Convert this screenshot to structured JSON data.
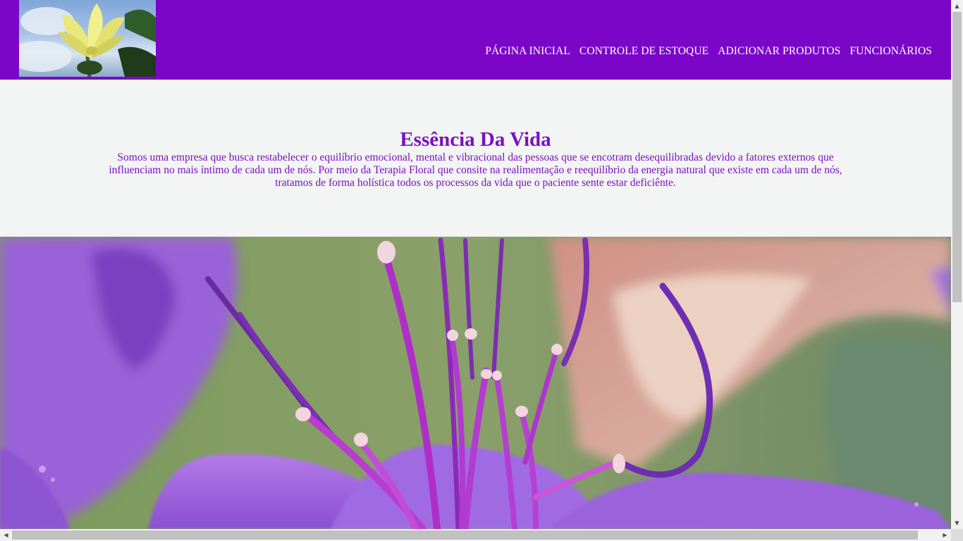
{
  "header": {
    "logo_alt": "Flor amarela",
    "nav": [
      {
        "label": "PÁGINA INICIAL"
      },
      {
        "label": "CONTROLE DE ESTOQUE"
      },
      {
        "label": "ADICIONAR PRODUTOS"
      },
      {
        "label": "FUNCIONÁRIOS"
      }
    ]
  },
  "intro": {
    "title": "Essência Da Vida",
    "text": "Somos uma empresa que busca restabelecer o equilíbrio emocional, mental e vibracional das pessoas que se encotram desequilibradas devido a fatores externos que influenciam no mais íntimo de cada um de nós. Por meio da Terapia Floral que consite na realimentação e reequilíbrio da energia natural que existe em cada um de nós, tratamos de forma holística todos os processos da vida que o paciente sente estar deficiênte."
  },
  "hero": {
    "alt": "Flor roxa"
  },
  "colors": {
    "header_bg": "#7b06c8",
    "accent_text": "#7a10c0",
    "section_bg": "#f3f4f4"
  }
}
